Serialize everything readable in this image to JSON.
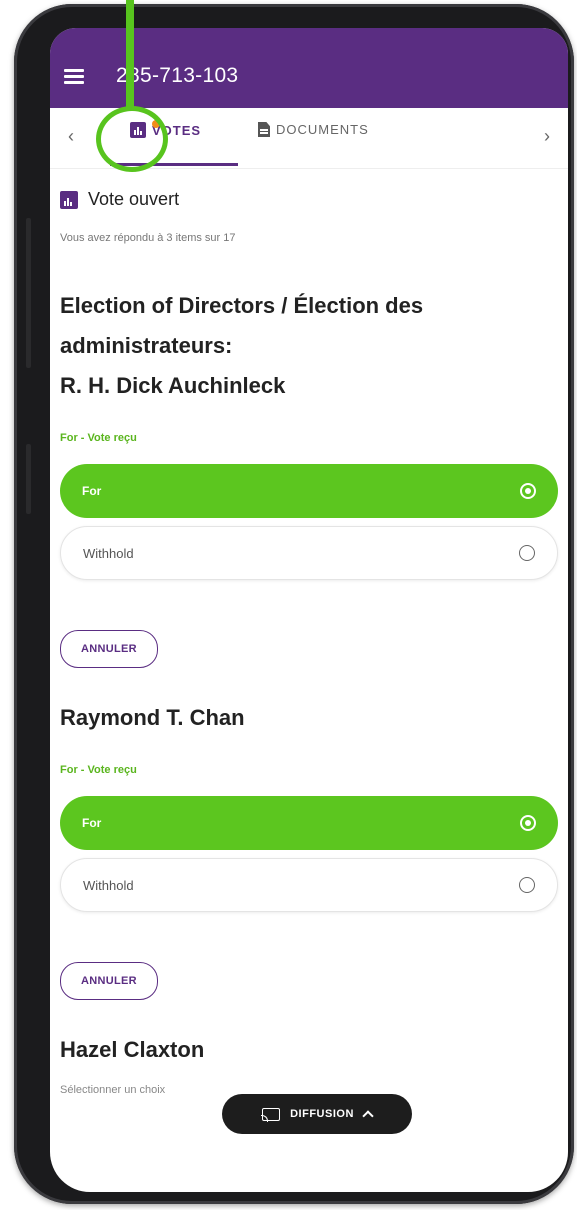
{
  "header": {
    "meeting_id": "285-713-103"
  },
  "tabs": [
    {
      "label": "VOTES",
      "active": true
    },
    {
      "label": "DOCUMENTS",
      "active": false
    }
  ],
  "nav": {
    "prev": "‹",
    "next": "›"
  },
  "status": {
    "title": "Vote ouvert",
    "progress": "Vous avez répondu à 3 items sur 17"
  },
  "items": [
    {
      "title_lines": [
        "Election of Directors / Élection des",
        "administrateurs:",
        "R. H. Dick Auchinleck"
      ],
      "status": "For - Vote reçu",
      "options": [
        "For",
        "Withhold"
      ],
      "selected": "For",
      "cancel": "ANNULER"
    },
    {
      "title_lines": [
        "Raymond T. Chan"
      ],
      "status": "For - Vote reçu",
      "options": [
        "For",
        "Withhold"
      ],
      "selected": "For",
      "cancel": "ANNULER"
    },
    {
      "title_lines": [
        "Hazel Claxton"
      ],
      "hint": "Sélectionner un choix"
    }
  ],
  "diffusion": {
    "label": "DIFFUSION"
  },
  "colors": {
    "brand_purple": "#5a2d82",
    "selected_green": "#5cc61f",
    "notification_orange": "#f28c1a",
    "annotation_green": "#58c41e"
  }
}
